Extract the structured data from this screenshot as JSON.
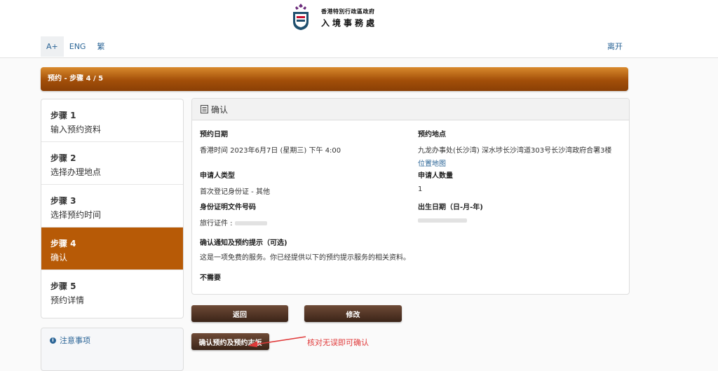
{
  "header": {
    "logo_line1": "香港特別行政區政府",
    "logo_line2": "入境事務處",
    "nav": [
      "A+",
      "ENG",
      "繁"
    ],
    "logout": "离开"
  },
  "banner": {
    "text": "预约 - 步骤 4 / 5"
  },
  "steps": [
    {
      "num": "步骤 1",
      "label": "输入预约资料"
    },
    {
      "num": "步骤 2",
      "label": "选择办理地点"
    },
    {
      "num": "步骤 3",
      "label": "选择预约时间"
    },
    {
      "num": "步骤 4",
      "label": "确认"
    },
    {
      "num": "步骤 5",
      "label": "预约详情"
    }
  ],
  "notes": {
    "item1": "注意事项"
  },
  "confirm": {
    "title": "确认",
    "date_label": "预约日期",
    "date_value": "香港时间 2023年6月7日 (星期三) 下午 4:00",
    "location_label": "预约地点",
    "location_value": "九龙办事处(长沙湾) 深水埗长沙湾道303号长沙湾政府合署3楼",
    "location_map": "位置地图",
    "applicant_type_label": "申请人类型",
    "applicant_type_value": "首次登记身份证 - 其他",
    "applicant_count_label": "申请人数量",
    "applicant_count_value": "1",
    "id_doc_label": "身份证明文件号码",
    "id_doc_value": "旅行证件 :",
    "dob_label": "出生日期（日-月-年)",
    "reminder_label": "确认通知及预约提示（可选)",
    "reminder_desc": "这是一项免费的服务。你已经提供以下的预约提示服务的相关资料。",
    "reminder_value": "不需要"
  },
  "buttons": {
    "back": "返回",
    "modify": "修改",
    "confirm": "确认预约及预约志坂"
  },
  "annotation": "核对无误即可确认",
  "colors": {
    "accent": "#b75a06",
    "button": "#4a2e20",
    "link": "#2a6496",
    "annotation": "#e03a3a"
  }
}
